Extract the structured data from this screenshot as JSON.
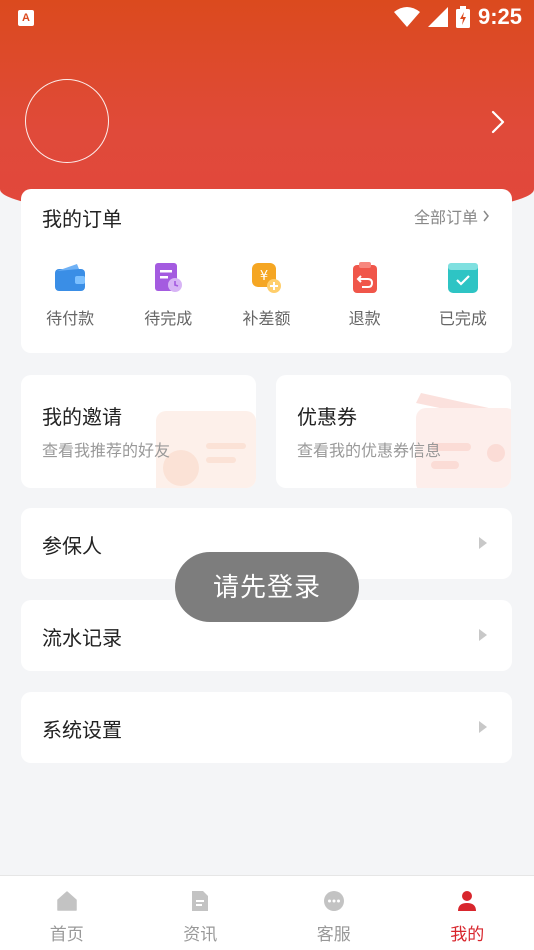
{
  "status_bar": {
    "time": "9:25",
    "app_icon_letter": "A"
  },
  "orders": {
    "title": "我的订单",
    "all_label": "全部订单",
    "items": [
      {
        "label": "待付款",
        "icon": "wallet-icon",
        "color": "#3a8ee6"
      },
      {
        "label": "待完成",
        "icon": "document-clock-icon",
        "color": "#a45be0"
      },
      {
        "label": "补差额",
        "icon": "yen-coin-plus-icon",
        "color": "#f5a623"
      },
      {
        "label": "退款",
        "icon": "clipboard-return-icon",
        "color": "#f0564a"
      },
      {
        "label": "已完成",
        "icon": "check-box-icon",
        "color": "#2ec4c4"
      }
    ]
  },
  "promos": [
    {
      "title": "我的邀请",
      "subtitle": "查看我推荐的好友"
    },
    {
      "title": "优惠券",
      "subtitle": "查看我的优惠券信息"
    }
  ],
  "rows": [
    {
      "label": "参保人"
    },
    {
      "label": "流水记录"
    },
    {
      "label": "系统设置"
    }
  ],
  "toast": "请先登录",
  "tabs": [
    {
      "label": "首页",
      "icon": "home-icon",
      "active": false
    },
    {
      "label": "资讯",
      "icon": "news-icon",
      "active": false
    },
    {
      "label": "客服",
      "icon": "chat-icon",
      "active": false
    },
    {
      "label": "我的",
      "icon": "profile-icon",
      "active": true
    }
  ],
  "colors": {
    "brand": "#db4a1e",
    "active_tab": "#d8262d"
  }
}
